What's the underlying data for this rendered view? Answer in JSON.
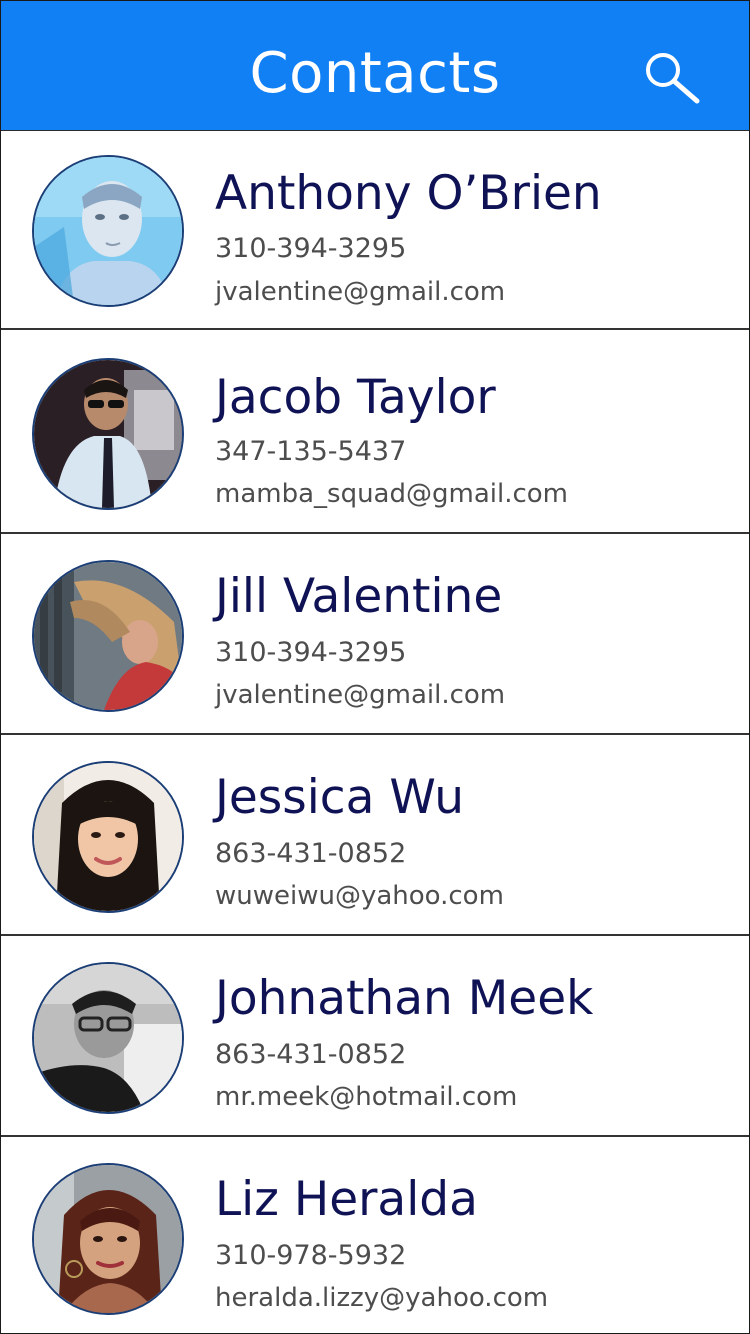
{
  "header": {
    "title": "Contacts",
    "search_icon": "search-icon",
    "background_color": "#1180f5"
  },
  "contacts": [
    {
      "name": "Anthony O’Brien",
      "phone": "310-394-3295",
      "email": "jvalentine@gmail.com",
      "avatar_icon": "avatar-photo"
    },
    {
      "name": "Jacob Taylor",
      "phone": "347-135-5437",
      "email": "mamba_squad@gmail.com",
      "avatar_icon": "avatar-photo"
    },
    {
      "name": "Jill Valentine",
      "phone": "310-394-3295",
      "email": "jvalentine@gmail.com",
      "avatar_icon": "avatar-photo"
    },
    {
      "name": "Jessica Wu",
      "phone": "863-431-0852",
      "email": "wuweiwu@yahoo.com",
      "avatar_icon": "avatar-photo"
    },
    {
      "name": "Johnathan Meek",
      "phone": "863-431-0852",
      "email": "mr.meek@hotmail.com",
      "avatar_icon": "avatar-photo"
    },
    {
      "name": "Liz Heralda",
      "phone": "310-978-5932",
      "email": "heralda.lizzy@yahoo.com",
      "avatar_icon": "avatar-photo"
    }
  ]
}
